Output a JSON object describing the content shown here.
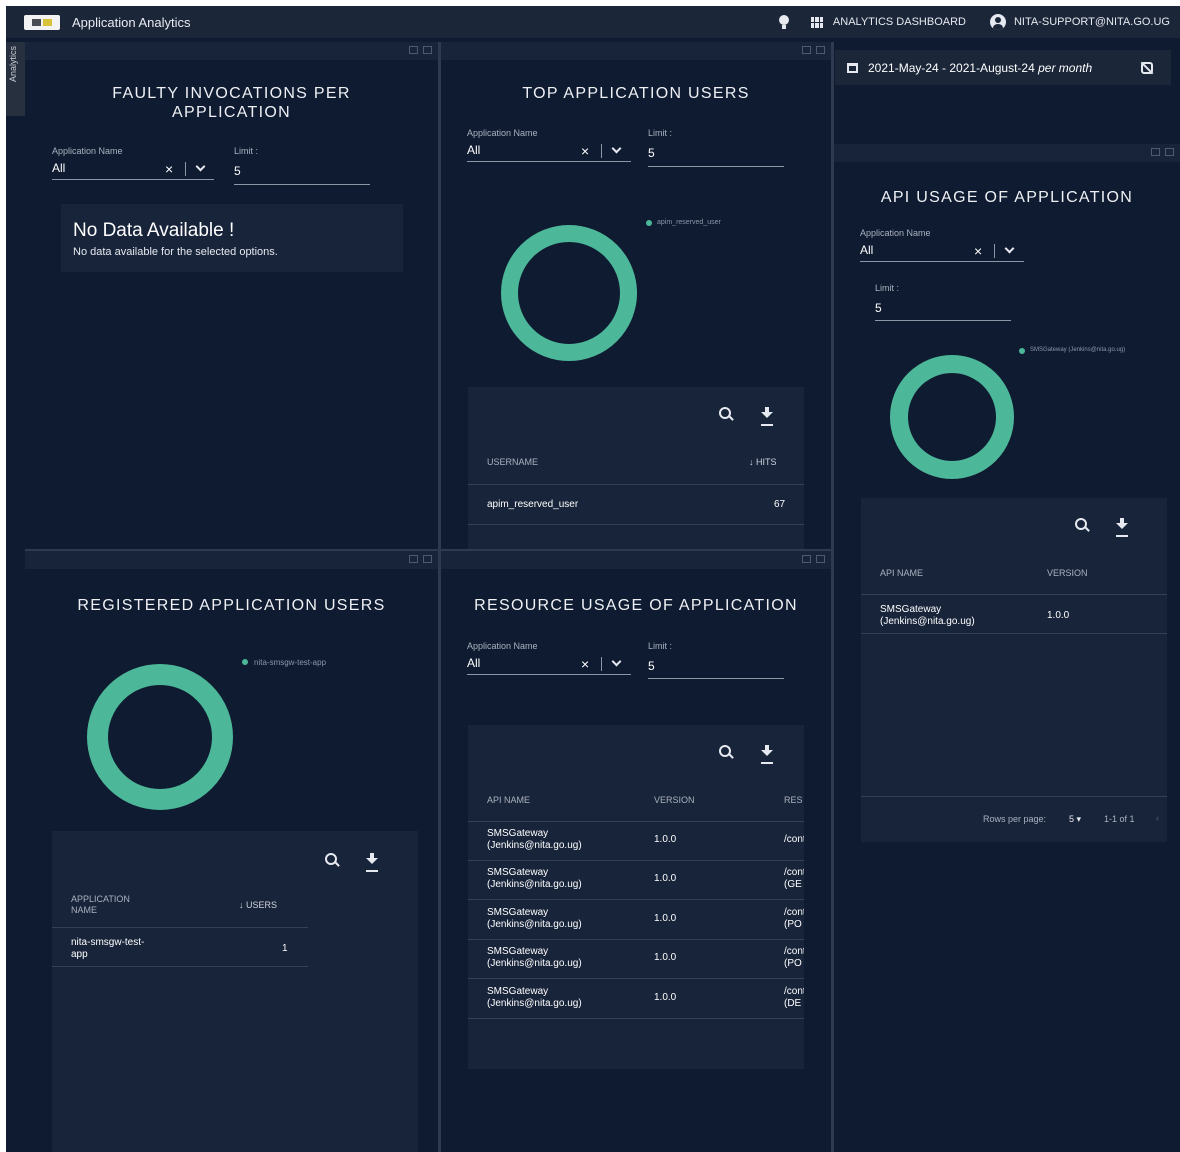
{
  "header": {
    "app_title": "Application Analytics",
    "dashboard_link": "ANALYTICS DASHBOARD",
    "user_email": "NITA-SUPPORT@NITA.GO.UG"
  },
  "sidebar": {
    "tab_label": "Analytics"
  },
  "date_range": {
    "range": "2021-May-24 - 2021-August-24",
    "granularity": "per month"
  },
  "faulty": {
    "title": "FAULTY INVOCATIONS PER APPLICATION",
    "app_name_label": "Application Name",
    "app_name_value": "All",
    "limit_label": "Limit :",
    "limit_value": "5",
    "no_data_title": "No Data Available !",
    "no_data_message": "No data available for the selected options."
  },
  "top_users": {
    "title": "TOP APPLICATION USERS",
    "app_name_label": "Application Name",
    "app_name_value": "All",
    "limit_label": "Limit :",
    "limit_value": "5",
    "legend": [
      "apim_reserved_user"
    ],
    "columns": [
      "USERNAME",
      "HITS"
    ],
    "rows": [
      {
        "username": "apim_reserved_user",
        "hits": "67"
      }
    ]
  },
  "api_usage": {
    "title": "API USAGE OF APPLICATION",
    "app_name_label": "Application Name",
    "app_name_value": "All",
    "limit_label": "Limit :",
    "limit_value": "5",
    "legend": [
      "SMSGateway (Jenkins@nita.go.ug)"
    ],
    "columns": [
      "API NAME",
      "VERSION"
    ],
    "rows": [
      {
        "api_name_line1": "SMSGateway",
        "api_name_line2": "(Jenkins@nita.go.ug)",
        "version": "1.0.0"
      }
    ],
    "rows_per_page_label": "Rows per page:",
    "rows_per_page_value": "5",
    "page_info": "1-1 of 1"
  },
  "registered_users": {
    "title": "REGISTERED APPLICATION USERS",
    "legend": [
      "nita-smsgw-test-app"
    ],
    "columns": [
      "APPLICATION NAME",
      "USERS"
    ],
    "col1_line1": "APPLICATION",
    "col1_line2": "NAME",
    "rows": [
      {
        "name_line1": "nita-smsgw-test-",
        "name_line2": "app",
        "users": "1"
      }
    ]
  },
  "resource_usage": {
    "title": "RESOURCE USAGE OF APPLICATION",
    "app_name_label": "Application Name",
    "app_name_value": "All",
    "limit_label": "Limit :",
    "limit_value": "5",
    "columns": [
      "API NAME",
      "VERSION",
      "RES"
    ],
    "rows": [
      {
        "line1": "SMSGateway",
        "line2": "(Jenkins@nita.go.ug)",
        "version": "1.0.0",
        "res1": "/cont",
        "res2": ""
      },
      {
        "line1": "SMSGateway",
        "line2": "(Jenkins@nita.go.ug)",
        "version": "1.0.0",
        "res1": "/cont",
        "res2": "(GE"
      },
      {
        "line1": "SMSGateway",
        "line2": "(Jenkins@nita.go.ug)",
        "version": "1.0.0",
        "res1": "/cont",
        "res2": "(PO"
      },
      {
        "line1": "SMSGateway",
        "line2": "(Jenkins@nita.go.ug)",
        "version": "1.0.0",
        "res1": "/cont",
        "res2": "(PO"
      },
      {
        "line1": "SMSGateway",
        "line2": "(Jenkins@nita.go.ug)",
        "version": "1.0.0",
        "res1": "/cont",
        "res2": "(DE"
      }
    ]
  },
  "colors": {
    "background": "#0f1b31",
    "accent_teal": "#4db899",
    "panel": "#18243a"
  }
}
